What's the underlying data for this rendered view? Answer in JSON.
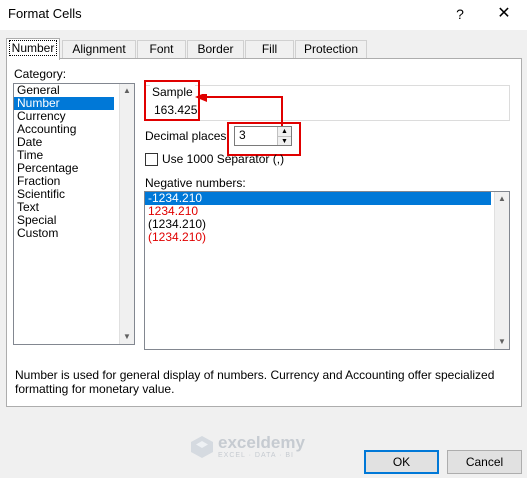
{
  "dialog": {
    "title": "Format Cells",
    "help_icon": "?",
    "close_icon": "✕"
  },
  "tabs": [
    {
      "label": "Number",
      "active": true
    },
    {
      "label": "Alignment"
    },
    {
      "label": "Font"
    },
    {
      "label": "Border"
    },
    {
      "label": "Fill"
    },
    {
      "label": "Protection"
    }
  ],
  "category": {
    "label": "Category:",
    "items": [
      "General",
      "Number",
      "Currency",
      "Accounting",
      "Date",
      "Time",
      "Percentage",
      "Fraction",
      "Scientific",
      "Text",
      "Special",
      "Custom"
    ],
    "selected": "Number"
  },
  "sample": {
    "label": "Sample",
    "value": "163.425"
  },
  "decimal_places": {
    "label": "Decimal places:",
    "value": "3"
  },
  "separator": {
    "label": "Use 1000 Separator (,)",
    "checked": false
  },
  "negative_numbers": {
    "label": "Negative numbers:",
    "items": [
      "-1234.210",
      "1234.210",
      "(1234.210)",
      "(1234.210)"
    ],
    "selected_index": 0
  },
  "description": "Number is used for general display of numbers.  Currency and Accounting offer specialized formatting for monetary value.",
  "watermark": {
    "name": "exceldemy",
    "tagline": "EXCEL · DATA · BI"
  },
  "buttons": {
    "ok": "OK",
    "cancel": "Cancel"
  },
  "colors": {
    "selection": "#0078d7",
    "highlight": "#e00000",
    "negative_red": "#e00000"
  }
}
